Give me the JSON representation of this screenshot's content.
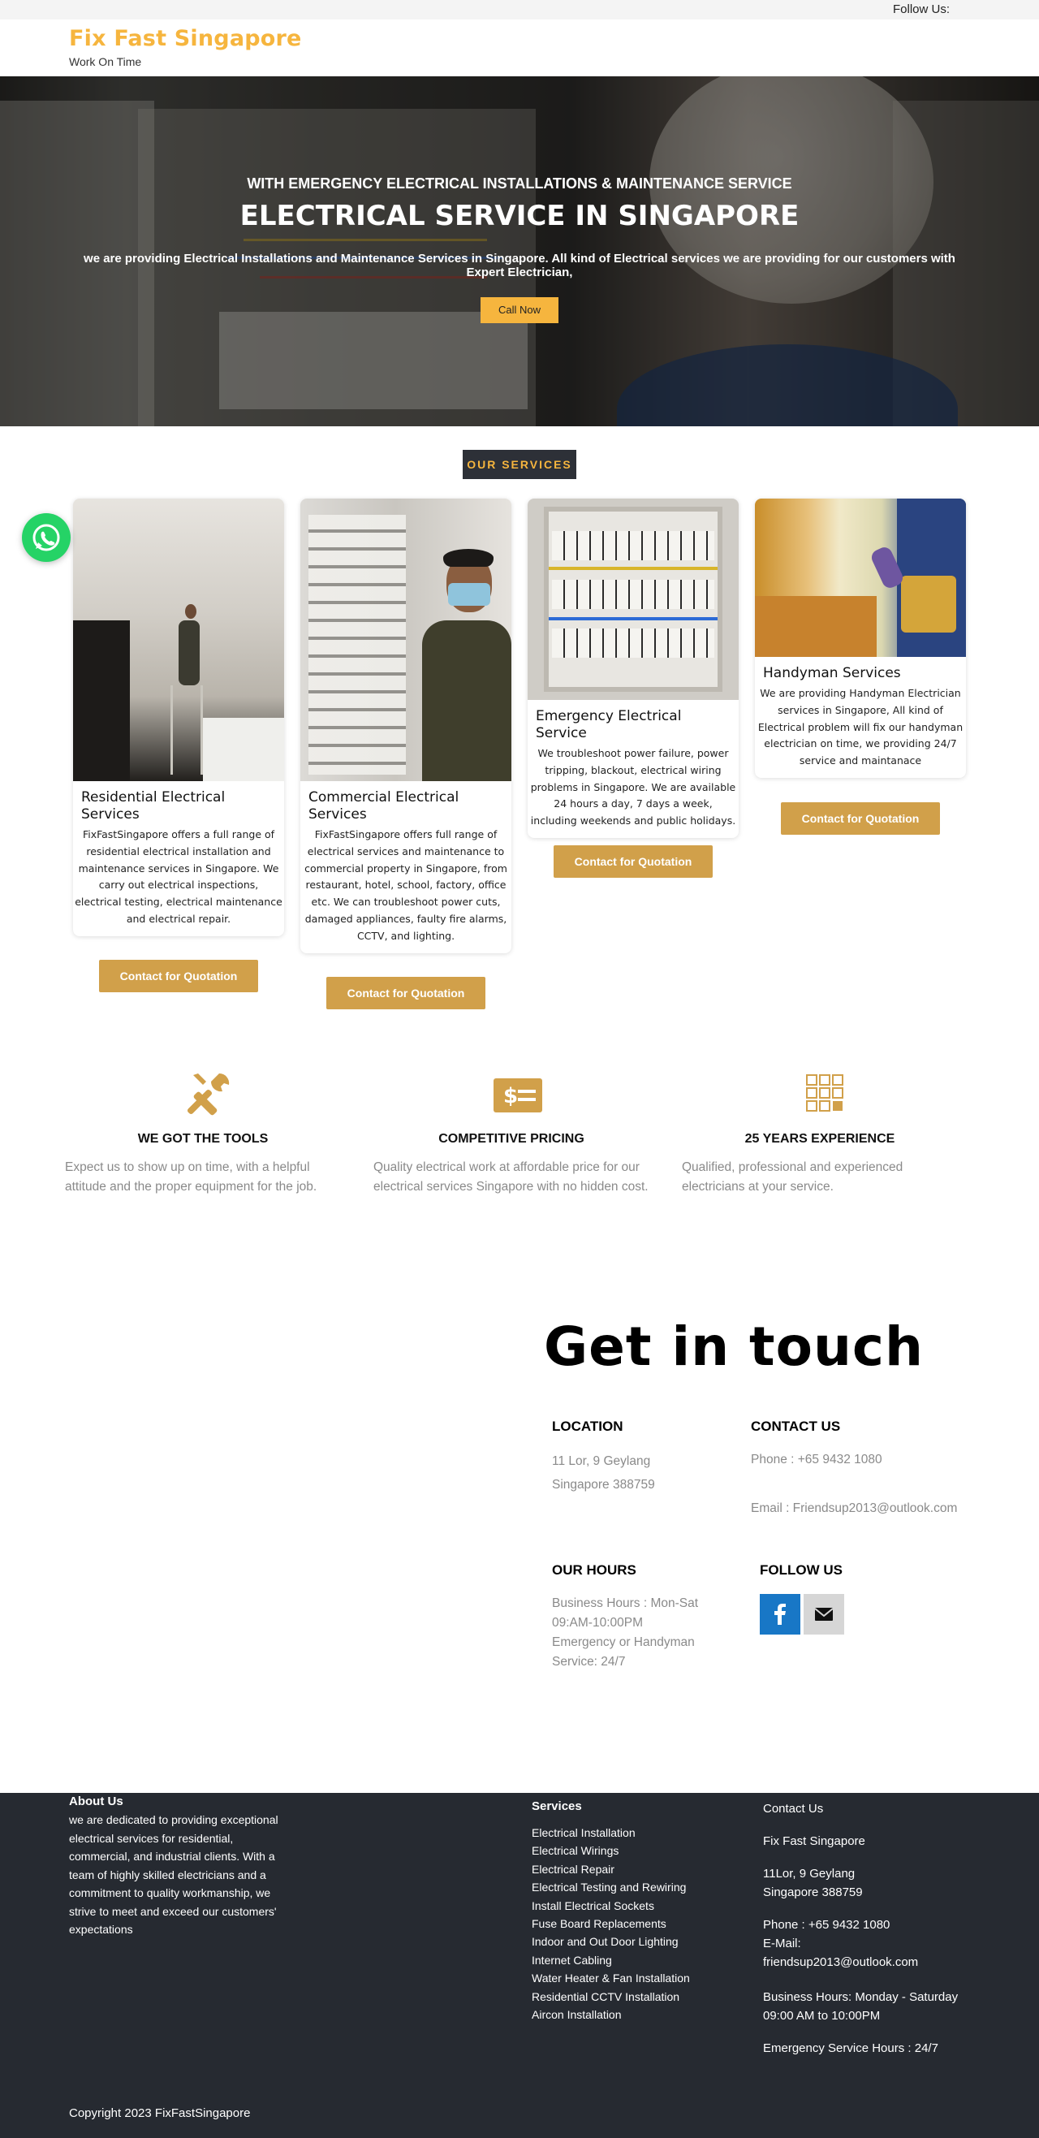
{
  "topbar": {
    "follow_label": "Follow Us:"
  },
  "header": {
    "brand": "Fix Fast Singapore",
    "tagline": "Work On Time"
  },
  "hero": {
    "subtitle": "WITH EMERGENCY ELECTRICAL INSTALLATIONS & MAINTENANCE SERVICE",
    "title": "ELECTRICAL SERVICE IN SINGAPORE",
    "description": "we are providing Electrical Installations and Maintenance Services in Singapore. All kind of Electrical services we are providing for our customers with Expert Electrician,",
    "cta_label": "Call Now"
  },
  "services": {
    "badge": "OUR SERVICES",
    "quote_label": "Contact for Quotation",
    "cards": [
      {
        "title": "Residential Electrical Services",
        "text": "FixFastSingapore offers a full range of residential electrical installation and maintenance services in Singapore. We carry out electrical inspections, electrical testing, electrical maintenance and electrical repair."
      },
      {
        "title": "Commercial Electrical Services",
        "text": "FixFastSingapore offers full range of electrical services and maintenance to commercial property in Singapore, from restaurant, hotel, school, factory, office etc. We can troubleshoot power cuts, damaged appliances, faulty fire alarms, CCTV, and lighting."
      },
      {
        "title": "Emergency Electrical Service",
        "text": "We troubleshoot power failure, power tripping, blackout, electrical wiring problems in Singapore. We are available 24 hours a day, 7 days a week, including weekends and public holidays."
      },
      {
        "title": "Handyman Services",
        "text": "We are providing Handyman Electrician services in Singapore, All kind of Electrical problem will fix our handyman electrician on time, we providing 24/7 service and maintanace"
      }
    ]
  },
  "features": [
    {
      "icon": "tools-icon",
      "title": "WE GOT THE TOOLS",
      "text": "Expect us to show up on time, with a helpful attitude and the proper equipment for the job."
    },
    {
      "icon": "dollar-card-icon",
      "title": "COMPETITIVE PRICING",
      "text": "Quality electrical work at affordable price for our electrical services Singapore with no hidden cost."
    },
    {
      "icon": "grid-icon",
      "title": "25 YEARS EXPERIENCE",
      "text": "Qualified, professional and experienced electricians at your service."
    }
  ],
  "contact": {
    "heading": "Get in touch",
    "location": {
      "title": "LOCATION",
      "line1": "11 Lor, 9 Geylang",
      "line2": "Singapore 388759"
    },
    "contact_us": {
      "title": "CONTACT US",
      "phone": "Phone : +65 9432 1080",
      "email": "Email : Friendsup2013@outlook.com"
    },
    "hours": {
      "title": "OUR HOURS",
      "line1": "Business Hours : Mon-Sat",
      "line2": "09:AM-10:00PM",
      "line3": "Emergency or Handyman",
      "line4": "Service: 24/7"
    },
    "follow": {
      "title": "FOLLOW US",
      "icons": [
        "facebook-icon",
        "envelope-icon"
      ]
    }
  },
  "footer": {
    "about_title": "About Us",
    "about_text": "we are dedicated to providing exceptional electrical services for residential, commercial, and industrial clients. With a team of highly skilled electricians and a commitment to quality workmanship, we strive to meet and exceed our customers' expectations",
    "services_title": "Services",
    "services": [
      "Electrical Installation",
      "Electrical Wirings",
      "Electrical Repair",
      "Electrical Testing and Rewiring",
      "Install Electrical Sockets",
      "Fuse Board Replacements",
      "Indoor and Out Door Lighting",
      "Internet Cabling",
      "Water Heater & Fan Installation",
      "Residential CCTV Installation",
      "Aircon Installation"
    ],
    "contact_title": "Contact Us",
    "company": "Fix Fast Singapore",
    "address1": "11Lor, 9 Geylang",
    "address2": "Singapore 388759",
    "phone": "Phone : +65 9432 1080",
    "email_label": "E-Mail:",
    "email": "friendsup2013@outlook.com",
    "hours1": "Business Hours: Monday - Saturday",
    "hours2": "09:00 AM to 10:00PM",
    "emergency": "Emergency Service Hours : 24/7",
    "copyright": "Copyright 2023 FixFastSingapore"
  },
  "colors": {
    "accent": "#f6b53e",
    "button": "#d1a04a",
    "dark": "#262a31",
    "whatsapp": "#25d366",
    "facebook": "#1877c6"
  }
}
